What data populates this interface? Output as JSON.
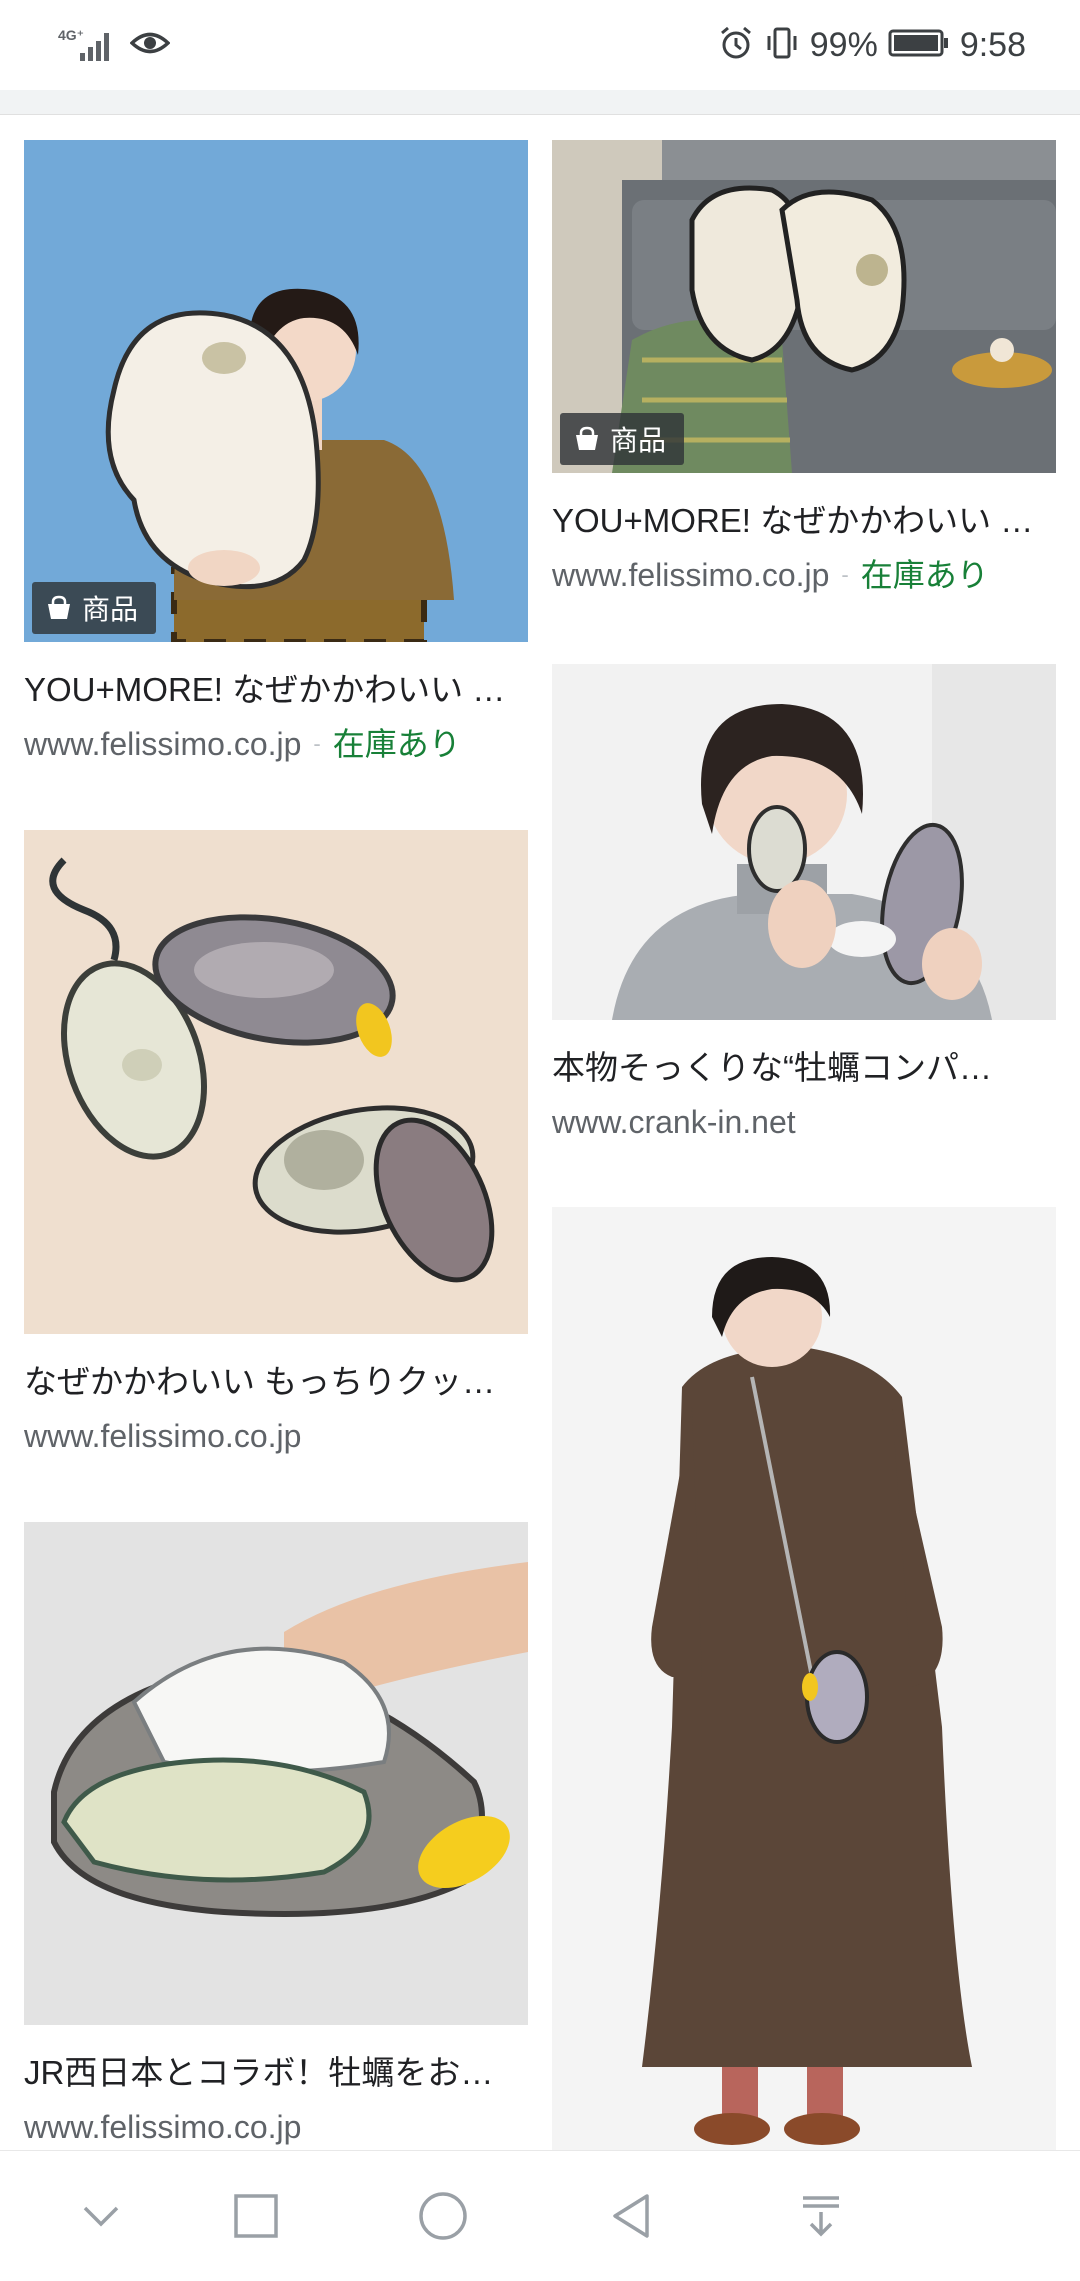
{
  "status_bar": {
    "network": "4G⁺",
    "battery": "99%",
    "time": "9:58",
    "icons": [
      "signal-icon",
      "eye-icon",
      "alarm-icon",
      "vibrate-icon",
      "battery-icon"
    ]
  },
  "results": {
    "left": [
      {
        "tag": "商品",
        "title": "YOU+MORE! なぜかかわいい …",
        "source": "www.felissimo.co.jp",
        "stock": "在庫あり"
      },
      {
        "title": "なぜかかわいい もっちりクッ…",
        "source": "www.felissimo.co.jp"
      },
      {
        "title": "JR西日本とコラボ！牡蠣をお…",
        "source": "www.felissimo.co.jp"
      }
    ],
    "right": [
      {
        "tag": "商品",
        "title": "YOU+MORE! なぜかかわいい …",
        "source": "www.felissimo.co.jp",
        "stock": "在庫あり"
      },
      {
        "title": "本物そっくりな“牡蠣コンパ…",
        "source": "www.crank-in.net"
      },
      {}
    ]
  },
  "nav_bar": {
    "icons": [
      "chevron-down-icon",
      "recents-square-icon",
      "home-circle-icon",
      "back-triangle-icon",
      "notification-pull-icon"
    ]
  },
  "colors": {
    "stock_green": "#188038",
    "tag_bg": "#303438",
    "url_grey": "#5f6368"
  }
}
